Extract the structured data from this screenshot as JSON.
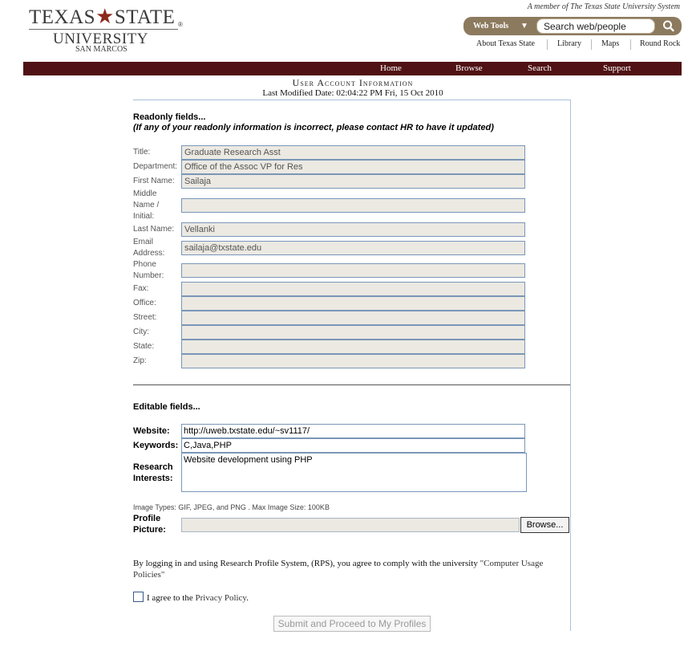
{
  "header": {
    "logo": {
      "line1_left": "TEXAS",
      "line1_right": "STATE",
      "line2": "UNIVERSITY",
      "line3": "SAN MARCOS",
      "registered": "®"
    },
    "member_text": "A member of The Texas State University System",
    "web_tools_label": "Web Tools",
    "search_value": "Search web/people",
    "top_links": [
      "About Texas State",
      "Library",
      "Maps",
      "Round Rock"
    ],
    "nav": [
      "Home",
      "Browse",
      "Search",
      "Support"
    ]
  },
  "page": {
    "title": "User Account Information",
    "last_modified": "Last Modified Date: 02:04:22 PM Fri, 15 Oct 2010"
  },
  "readonly": {
    "heading": "Readonly fields...",
    "note": "(If any of your readonly information is incorrect, please contact HR to have it updated)",
    "fields": [
      {
        "label": "Title:",
        "value": "Graduate Research Asst"
      },
      {
        "label": "Department:",
        "value": "Office of the Assoc VP for Res"
      },
      {
        "label": "First Name:",
        "value": "Sailaja"
      },
      {
        "label": "Middle Name / Initial:",
        "value": ""
      },
      {
        "label": "Last Name:",
        "value": "Vellanki"
      },
      {
        "label": "Email Address:",
        "value": "sailaja@txstate.edu"
      },
      {
        "label": "Phone Number:",
        "value": ""
      },
      {
        "label": "Fax:",
        "value": ""
      },
      {
        "label": "Office:",
        "value": ""
      },
      {
        "label": "Street:",
        "value": ""
      },
      {
        "label": "City:",
        "value": ""
      },
      {
        "label": "State:",
        "value": ""
      },
      {
        "label": "Zip:",
        "value": ""
      }
    ]
  },
  "editable": {
    "heading": "Editable fields...",
    "website_label": "Website:",
    "website_value": "http://uweb.txstate.edu/~sv1117/",
    "keywords_label": "Keywords:",
    "keywords_value": "C,Java,PHP",
    "research_label": "Research Interests:",
    "research_value": "Website development using PHP",
    "image_info": "Image Types: GIF, JPEG, and PNG   .  Max Image Size: 100KB",
    "profile_label": "Profile Picture:",
    "browse_label": "Browse..."
  },
  "terms": {
    "text": "By logging in and using Research Profile System, (RPS), you agree to comply with the university ",
    "link": "\"Computer Usage Policies\"",
    "agree_prefix": "I agree to the ",
    "agree_link": "Privacy Policy",
    "agree_suffix": "."
  },
  "submit_label": "Submit and Proceed to My Profiles",
  "colors": {
    "navbar": "#501214",
    "web_tools": "#8c7a5e",
    "readonly_bg": "#ebe9e2",
    "field_border": "#7a96b8"
  }
}
